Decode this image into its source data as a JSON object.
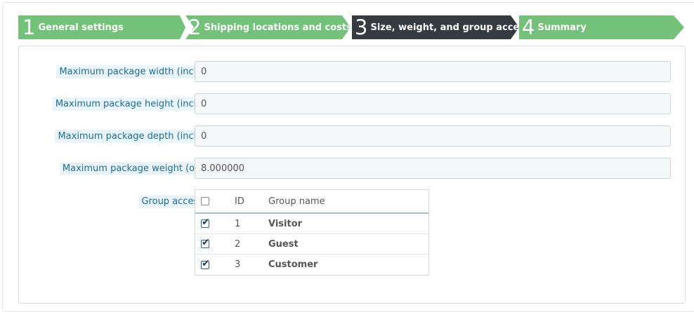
{
  "wizard": {
    "steps": [
      {
        "num": "1",
        "label": "General settings",
        "state": "done"
      },
      {
        "num": "2",
        "label": "Shipping locations and costs",
        "state": "done"
      },
      {
        "num": "3",
        "label": "Size, weight, and group access",
        "state": "current"
      },
      {
        "num": "4",
        "label": "Summary",
        "state": "todo"
      }
    ]
  },
  "form": {
    "width": {
      "label": "Maximum package width (inch)",
      "value": "0"
    },
    "height": {
      "label": "Maximum package height (inch)",
      "value": "0"
    },
    "depth": {
      "label": "Maximum package depth (inch)",
      "value": "0"
    },
    "weight": {
      "label": "Maximum package weight (oz)",
      "value": "8.000000"
    },
    "group_access": {
      "label": "Group access",
      "columns": {
        "id": "ID",
        "name": "Group name"
      },
      "select_all_checked": false,
      "rows": [
        {
          "id": "1",
          "name": "Visitor",
          "checked": true
        },
        {
          "id": "2",
          "name": "Guest",
          "checked": true
        },
        {
          "id": "3",
          "name": "Customer",
          "checked": true
        }
      ]
    }
  },
  "colors": {
    "step_done": "#72c279",
    "step_current": "#363a41",
    "label_bg": "#e9f5fb",
    "label_text": "#1e6d98"
  }
}
